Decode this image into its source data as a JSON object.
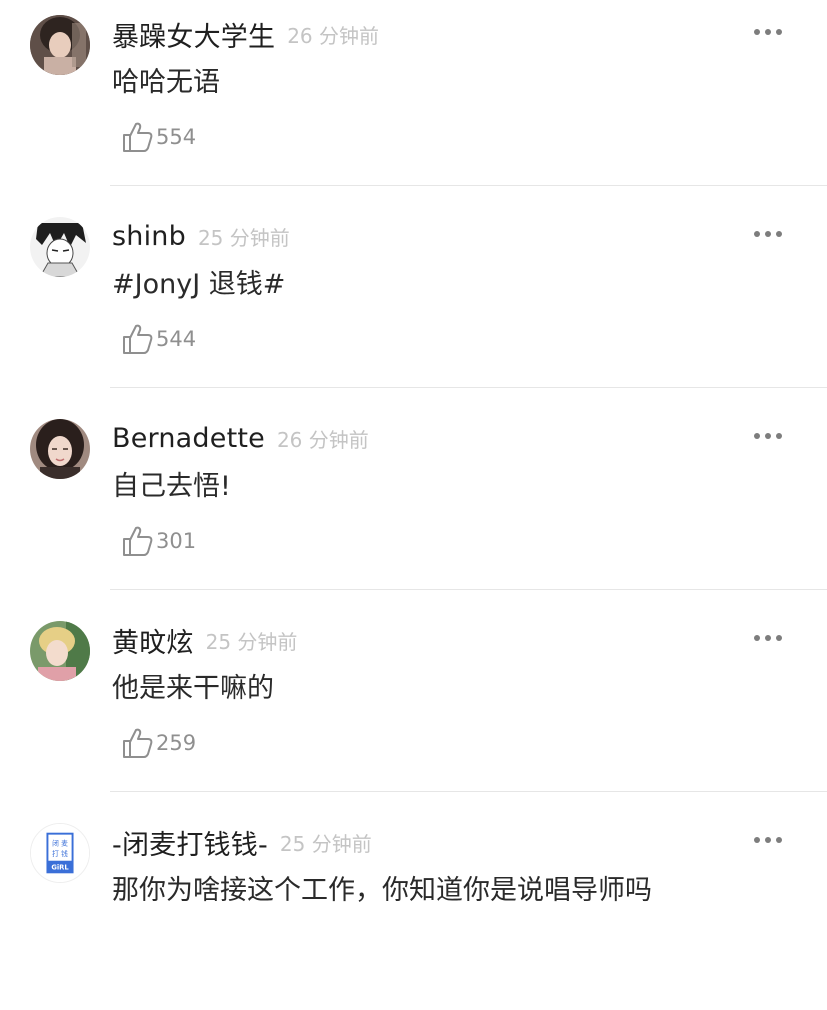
{
  "comments": [
    {
      "username": "暴躁女大学生",
      "time": "26 分钟前",
      "text": "哈哈无语",
      "likes": "554",
      "avatar_icon": "avatar-photo-girl-dark-hair",
      "avatar_color": "#5a4a45"
    },
    {
      "username": "shinb",
      "time": "25 分钟前",
      "text": "#JonyJ 退钱#",
      "likes": "544",
      "avatar_icon": "avatar-anime-sketch",
      "avatar_color": "#2b2b2b"
    },
    {
      "username": "Bernadette",
      "time": "26 分钟前",
      "text": "自己去悟!",
      "likes": "301",
      "avatar_icon": "avatar-photo-woman",
      "avatar_color": "#3c2f2c"
    },
    {
      "username": "黄旼炫",
      "time": "25 分钟前",
      "text": "他是来干嘛的",
      "likes": "259",
      "avatar_icon": "avatar-photo-blond-man",
      "avatar_color": "#d9c27a"
    },
    {
      "username": "-闭麦打钱钱-",
      "time": "25 分钟前",
      "text": "那你为啥接这个工作，你知道你是说唱导师吗",
      "likes": "",
      "avatar_icon": "avatar-girl-logo",
      "avatar_color": "#3a6fd8",
      "avatar_text": [
        "闭 麦",
        "打 钱",
        "GiRL"
      ]
    }
  ],
  "icons": {
    "more": "more-dots-icon",
    "like": "thumbs-up-outline-icon"
  },
  "colors": {
    "username": "#1f1f1f",
    "timestamp": "#c4c4c4",
    "like_count": "#8f8f8f",
    "divider": "#e6e6e6"
  }
}
